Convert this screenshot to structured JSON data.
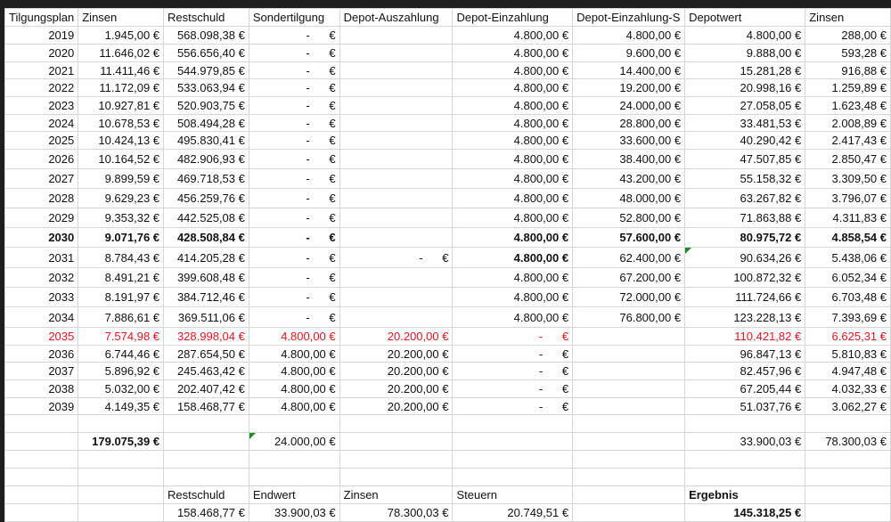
{
  "headers": [
    "Tilgungsplan",
    "Zinsen",
    "Restschuld",
    "Sondertilgung",
    "Depot-Auszahlung",
    "Depot-Einzahlung",
    "Depot-Einzahlung-S",
    "Depotwert",
    "Zinsen"
  ],
  "rows": [
    {
      "cells": [
        "2019",
        "1.945,00 €",
        "568.098,38 €",
        "-      €",
        "",
        "4.800,00 €",
        "4.800,00 €",
        "4.800,00 €",
        "288,00 €"
      ]
    },
    {
      "cells": [
        "2020",
        "11.646,02 €",
        "556.656,40 €",
        "-      €",
        "",
        "4.800,00 €",
        "9.600,00 €",
        "9.888,00 €",
        "593,28 €"
      ]
    },
    {
      "cells": [
        "2021",
        "11.411,46 €",
        "544.979,85 €",
        "-      €",
        "",
        "4.800,00 €",
        "14.400,00 €",
        "15.281,28 €",
        "916,88 €"
      ]
    },
    {
      "cells": [
        "2022",
        "11.172,09 €",
        "533.063,94 €",
        "-      €",
        "",
        "4.800,00 €",
        "19.200,00 €",
        "20.998,16 €",
        "1.259,89 €"
      ]
    },
    {
      "cells": [
        "2023",
        "10.927,81 €",
        "520.903,75 €",
        "-      €",
        "",
        "4.800,00 €",
        "24.000,00 €",
        "27.058,05 €",
        "1.623,48 €"
      ]
    },
    {
      "cells": [
        "2024",
        "10.678,53 €",
        "508.494,28 €",
        "-      €",
        "",
        "4.800,00 €",
        "28.800,00 €",
        "33.481,53 €",
        "2.008,89 €"
      ]
    },
    {
      "cells": [
        "2025",
        "10.424,13 €",
        "495.830,41 €",
        "-      €",
        "",
        "4.800,00 €",
        "33.600,00 €",
        "40.290,42 €",
        "2.417,43 €"
      ]
    },
    {
      "cells": [
        "2026",
        "10.164,52 €",
        "482.906,93 €",
        "-      €",
        "",
        "4.800,00 €",
        "38.400,00 €",
        "47.507,85 €",
        "2.850,47 €"
      ]
    },
    {
      "cells": [
        "2027",
        "9.899,59 €",
        "469.718,53 €",
        "-      €",
        "",
        "4.800,00 €",
        "43.200,00 €",
        "55.158,32 €",
        "3.309,50 €"
      ]
    },
    {
      "cells": [
        "2028",
        "9.629,23 €",
        "456.259,76 €",
        "-      €",
        "",
        "4.800,00 €",
        "48.000,00 €",
        "63.267,82 €",
        "3.796,07 €"
      ]
    },
    {
      "cells": [
        "2029",
        "9.353,32 €",
        "442.525,08 €",
        "-      €",
        "",
        "4.800,00 €",
        "52.800,00 €",
        "71.863,88 €",
        "4.311,83 €"
      ]
    },
    {
      "cells": [
        "2030",
        "9.071,76 €",
        "428.508,84 €",
        "-      €",
        "",
        "4.800,00 €",
        "57.600,00 €",
        "80.975,72 €",
        "4.858,54 €"
      ],
      "style": "b"
    },
    {
      "cells": [
        "2031",
        "8.784,43 €",
        "414.205,28 €",
        "-      €",
        "-      €",
        "4.800,00 €",
        "62.400,00 €",
        "90.634,26 €",
        "5.438,06 €"
      ],
      "boldCol": 5,
      "triCol": 7
    },
    {
      "cells": [
        "2032",
        "8.491,21 €",
        "399.608,48 €",
        "-      €",
        "",
        "4.800,00 €",
        "67.200,00 €",
        "100.872,32 €",
        "6.052,34 €"
      ]
    },
    {
      "cells": [
        "2033",
        "8.191,97 €",
        "384.712,46 €",
        "-      €",
        "",
        "4.800,00 €",
        "72.000,00 €",
        "111.724,66 €",
        "6.703,48 €"
      ]
    },
    {
      "cells": [
        "2034",
        "7.886,61 €",
        "369.511,06 €",
        "-      €",
        "",
        "4.800,00 €",
        "76.800,00 €",
        "123.228,13 €",
        "7.393,69 €"
      ]
    },
    {
      "cells": [
        "2035",
        "7.574,98 €",
        "328.998,04 €",
        "4.800,00 €",
        "20.200,00 €",
        "-      €",
        "",
        "110.421,82 €",
        "6.625,31 €"
      ],
      "style": "red"
    },
    {
      "cells": [
        "2036",
        "6.744,46 €",
        "287.654,50 €",
        "4.800,00 €",
        "20.200,00 €",
        "-      €",
        "",
        "96.847,13 €",
        "5.810,83 €"
      ]
    },
    {
      "cells": [
        "2037",
        "5.896,92 €",
        "245.463,42 €",
        "4.800,00 €",
        "20.200,00 €",
        "-      €",
        "",
        "82.457,96 €",
        "4.947,48 €"
      ]
    },
    {
      "cells": [
        "2038",
        "5.032,00 €",
        "202.407,42 €",
        "4.800,00 €",
        "20.200,00 €",
        "-      €",
        "",
        "67.205,44 €",
        "4.032,33 €"
      ]
    },
    {
      "cells": [
        "2039",
        "4.149,35 €",
        "158.468,77 €",
        "4.800,00 €",
        "20.200,00 €",
        "-      €",
        "",
        "51.037,76 €",
        "3.062,27 €"
      ]
    },
    {
      "cells": [
        "",
        "",
        "",
        "",
        "",
        "",
        "",
        "",
        ""
      ]
    },
    {
      "cells": [
        "",
        "179.075,39 €",
        "",
        "24.000,00 €",
        "",
        "",
        "",
        "33.900,03 €",
        "78.300,03 €"
      ],
      "boldCol": 1,
      "triCol": 3
    },
    {
      "cells": [
        "",
        "",
        "",
        "",
        "",
        "",
        "",
        "",
        ""
      ]
    },
    {
      "cells": [
        "",
        "",
        "",
        "",
        "",
        "",
        "",
        "",
        ""
      ]
    },
    {
      "cells": [
        "",
        "",
        "Restschuld",
        "Endwert",
        "Zinsen",
        "Steuern",
        "",
        "Ergebnis",
        ""
      ],
      "left": true,
      "boldCol": 7
    },
    {
      "cells": [
        "",
        "",
        "158.468,77 €",
        "33.900,03 €",
        "78.300,03 €",
        "20.749,51 €",
        "",
        "145.318,25 €",
        ""
      ],
      "boldCol": 7
    }
  ]
}
